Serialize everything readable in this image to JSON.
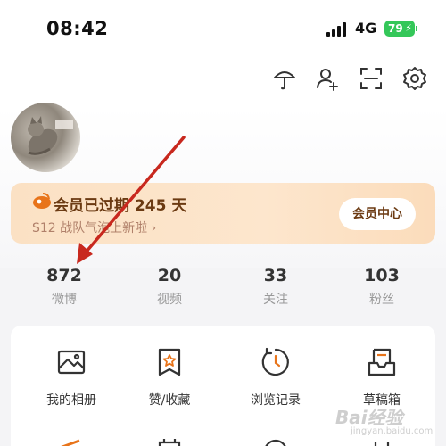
{
  "status_bar": {
    "time": "08:42",
    "network": "4G",
    "battery": "79"
  },
  "toolbar": {
    "icons": [
      "umbrella-icon",
      "add-friend-icon",
      "scan-icon",
      "settings-icon"
    ]
  },
  "vip_banner": {
    "title": "会员已过期 245 天",
    "subtitle": "S12 战队气泡上新啦 ›",
    "button": "会员中心"
  },
  "stats": [
    {
      "value": "872",
      "label": "微博"
    },
    {
      "value": "20",
      "label": "视频"
    },
    {
      "value": "33",
      "label": "关注"
    },
    {
      "value": "103",
      "label": "粉丝"
    }
  ],
  "grid": [
    {
      "label": "我的相册",
      "icon": "album-icon"
    },
    {
      "label": "赞/收藏",
      "icon": "favorite-icon"
    },
    {
      "label": "浏览记录",
      "icon": "history-icon"
    },
    {
      "label": "草稿箱",
      "icon": "drafts-icon"
    }
  ],
  "watermark": {
    "text": "Bai经验",
    "sub": "jingyan.baidu.com"
  },
  "colors": {
    "accent": "#e8741a",
    "vip_text": "#6b3a12",
    "arrow": "#c8281e",
    "battery": "#34c759"
  }
}
